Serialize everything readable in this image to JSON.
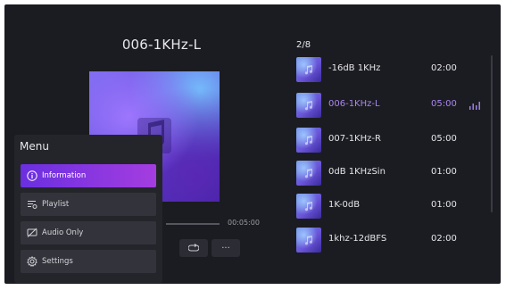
{
  "now_playing": {
    "title": "006-1KHz-L",
    "duration": "00:05:00"
  },
  "controls": {
    "repeat_icon": "repeat-icon",
    "more_label": "···"
  },
  "queue": {
    "counter": "2/8",
    "tracks": [
      {
        "name": "-16dB 1KHz",
        "duration": "02:00",
        "active": false
      },
      {
        "name": "006-1KHz-L",
        "duration": "05:00",
        "active": true
      },
      {
        "name": "007-1KHz-R",
        "duration": "05:00",
        "active": false
      },
      {
        "name": "0dB 1KHzSin",
        "duration": "01:00",
        "active": false
      },
      {
        "name": "1K-0dB",
        "duration": "01:00",
        "active": false
      },
      {
        "name": "1khz-12dBFS",
        "duration": "02:00",
        "active": false
      }
    ]
  },
  "menu": {
    "title": "Menu",
    "items": [
      {
        "label": "Information",
        "icon": "info-icon",
        "selected": true
      },
      {
        "label": "Playlist",
        "icon": "playlist-icon",
        "selected": false
      },
      {
        "label": "Audio Only",
        "icon": "screen-off-icon",
        "selected": false
      },
      {
        "label": "Settings",
        "icon": "gear-icon",
        "selected": false
      }
    ]
  },
  "colors": {
    "background": "#1b1c21",
    "accent": "#a886ee",
    "menu_selected_start": "#6a2fe0",
    "menu_selected_end": "#a43de0"
  }
}
